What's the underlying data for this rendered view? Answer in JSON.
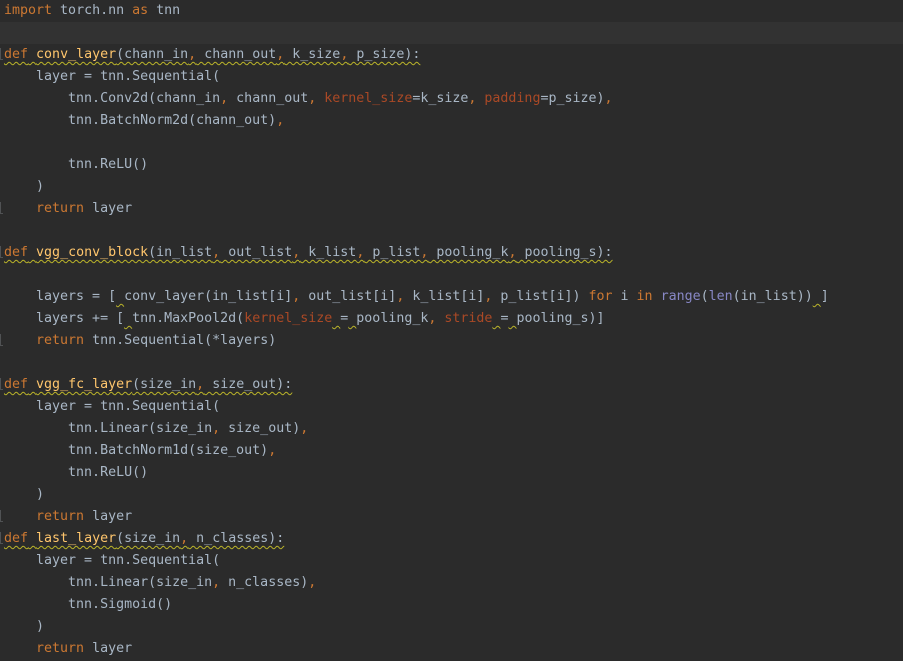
{
  "editor": {
    "lines": [
      [
        {
          "t": "import",
          "c": "kw"
        },
        {
          "t": " torch.nn ",
          "c": "nm"
        },
        {
          "t": "as",
          "c": "kw"
        },
        {
          "t": " tnn",
          "c": "nm"
        }
      ],
      [],
      [
        {
          "t": "def",
          "c": "kw",
          "w": 1
        },
        {
          "t": " ",
          "c": "nm",
          "w": 1
        },
        {
          "t": "conv_layer",
          "c": "fn",
          "w": 1
        },
        {
          "t": "(chann_in",
          "c": "nm",
          "w": 1
        },
        {
          "t": ",",
          "c": "pn",
          "w": 1
        },
        {
          "t": " chann_out",
          "c": "nm",
          "w": 1
        },
        {
          "t": ",",
          "c": "pn",
          "w": 1
        },
        {
          "t": " k_size",
          "c": "nm",
          "w": 1
        },
        {
          "t": ",",
          "c": "pn",
          "w": 1
        },
        {
          "t": " p_size):",
          "c": "nm",
          "w": 1
        }
      ],
      [
        {
          "t": "    layer = tnn.Sequential(",
          "c": "nm"
        }
      ],
      [
        {
          "t": "        tnn.Conv2d(chann_in",
          "c": "nm"
        },
        {
          "t": ",",
          "c": "pn"
        },
        {
          "t": " chann_out",
          "c": "nm"
        },
        {
          "t": ",",
          "c": "pn"
        },
        {
          "t": " ",
          "c": "nm"
        },
        {
          "t": "kernel_size",
          "c": "pr"
        },
        {
          "t": "=k_size",
          "c": "nm"
        },
        {
          "t": ",",
          "c": "pn"
        },
        {
          "t": " ",
          "c": "nm"
        },
        {
          "t": "padding",
          "c": "pr"
        },
        {
          "t": "=p_size)",
          "c": "nm"
        },
        {
          "t": ",",
          "c": "pn"
        }
      ],
      [
        {
          "t": "        tnn.BatchNorm2d(chann_out)",
          "c": "nm"
        },
        {
          "t": ",",
          "c": "pn"
        }
      ],
      [],
      [
        {
          "t": "        tnn.ReLU()",
          "c": "nm"
        }
      ],
      [
        {
          "t": "    )",
          "c": "nm"
        }
      ],
      [
        {
          "t": "    ",
          "c": "nm"
        },
        {
          "t": "return",
          "c": "kw"
        },
        {
          "t": " layer",
          "c": "nm"
        }
      ],
      [],
      [
        {
          "t": "def",
          "c": "kw",
          "w": 1
        },
        {
          "t": " ",
          "c": "nm",
          "w": 1
        },
        {
          "t": "vgg_conv_block",
          "c": "fn",
          "w": 1
        },
        {
          "t": "(in_list",
          "c": "nm",
          "w": 1
        },
        {
          "t": ",",
          "c": "pn",
          "w": 1
        },
        {
          "t": " out_list",
          "c": "nm",
          "w": 1
        },
        {
          "t": ",",
          "c": "pn",
          "w": 1
        },
        {
          "t": " k_list",
          "c": "nm",
          "w": 1
        },
        {
          "t": ",",
          "c": "pn",
          "w": 1
        },
        {
          "t": " p_list",
          "c": "nm",
          "w": 1
        },
        {
          "t": ",",
          "c": "pn",
          "w": 1
        },
        {
          "t": " pooling_k",
          "c": "nm",
          "w": 1
        },
        {
          "t": ",",
          "c": "pn",
          "w": 1
        },
        {
          "t": " pooling_s):",
          "c": "nm",
          "w": 1
        }
      ],
      [],
      [
        {
          "t": "    layers = [",
          "c": "nm"
        },
        {
          "t": " ",
          "c": "nm",
          "w": 1
        },
        {
          "t": "conv_layer(in_list[i]",
          "c": "nm"
        },
        {
          "t": ",",
          "c": "pn"
        },
        {
          "t": " out_list[i]",
          "c": "nm"
        },
        {
          "t": ",",
          "c": "pn"
        },
        {
          "t": " k_list[i]",
          "c": "nm"
        },
        {
          "t": ",",
          "c": "pn"
        },
        {
          "t": " p_list[i]) ",
          "c": "nm"
        },
        {
          "t": "for",
          "c": "kw"
        },
        {
          "t": " i ",
          "c": "nm"
        },
        {
          "t": "in",
          "c": "kw"
        },
        {
          "t": " ",
          "c": "nm"
        },
        {
          "t": "range",
          "c": "bi"
        },
        {
          "t": "(",
          "c": "nm"
        },
        {
          "t": "len",
          "c": "bi"
        },
        {
          "t": "(in_list))",
          "c": "nm"
        },
        {
          "t": " ",
          "c": "nm",
          "w": 1
        },
        {
          "t": "]",
          "c": "nm"
        }
      ],
      [
        {
          "t": "    layers += [",
          "c": "nm"
        },
        {
          "t": " ",
          "c": "nm",
          "w": 1
        },
        {
          "t": "tnn.MaxPool2d(",
          "c": "nm"
        },
        {
          "t": "kernel_size",
          "c": "pr"
        },
        {
          "t": " ",
          "c": "nm",
          "w": 1
        },
        {
          "t": "=",
          "c": "nm"
        },
        {
          "t": " ",
          "c": "nm",
          "w": 1
        },
        {
          "t": "pooling_k",
          "c": "nm"
        },
        {
          "t": ",",
          "c": "pn"
        },
        {
          "t": " ",
          "c": "nm"
        },
        {
          "t": "stride",
          "c": "pr"
        },
        {
          "t": " ",
          "c": "nm",
          "w": 1
        },
        {
          "t": "=",
          "c": "nm"
        },
        {
          "t": " ",
          "c": "nm",
          "w": 1
        },
        {
          "t": "pooling_s)]",
          "c": "nm"
        }
      ],
      [
        {
          "t": "    ",
          "c": "nm"
        },
        {
          "t": "return",
          "c": "kw"
        },
        {
          "t": " tnn.Sequential(*layers)",
          "c": "nm"
        }
      ],
      [],
      [
        {
          "t": "def",
          "c": "kw",
          "w": 1
        },
        {
          "t": " ",
          "c": "nm",
          "w": 1
        },
        {
          "t": "vgg_fc_layer",
          "c": "fn",
          "w": 1
        },
        {
          "t": "(size_in",
          "c": "nm",
          "w": 1
        },
        {
          "t": ",",
          "c": "pn",
          "w": 1
        },
        {
          "t": " size_out):",
          "c": "nm",
          "w": 1
        }
      ],
      [
        {
          "t": "    layer = tnn.Sequential(",
          "c": "nm"
        }
      ],
      [
        {
          "t": "        tnn.Linear(size_in",
          "c": "nm"
        },
        {
          "t": ",",
          "c": "pn"
        },
        {
          "t": " size_out)",
          "c": "nm"
        },
        {
          "t": ",",
          "c": "pn"
        }
      ],
      [
        {
          "t": "        tnn.BatchNorm1d(size_out)",
          "c": "nm"
        },
        {
          "t": ",",
          "c": "pn"
        }
      ],
      [
        {
          "t": "        tnn.ReLU()",
          "c": "nm"
        }
      ],
      [
        {
          "t": "    )",
          "c": "nm"
        }
      ],
      [
        {
          "t": "    ",
          "c": "nm"
        },
        {
          "t": "return",
          "c": "kw"
        },
        {
          "t": " layer",
          "c": "nm"
        }
      ],
      [
        {
          "t": "def",
          "c": "kw",
          "w": 1
        },
        {
          "t": " ",
          "c": "nm",
          "w": 1
        },
        {
          "t": "last_layer",
          "c": "fn",
          "w": 1
        },
        {
          "t": "(size_in",
          "c": "nm",
          "w": 1
        },
        {
          "t": ",",
          "c": "pn",
          "w": 1
        },
        {
          "t": " n_classes):",
          "c": "nm",
          "w": 1
        }
      ],
      [
        {
          "t": "    layer = tnn.Sequential(",
          "c": "nm"
        }
      ],
      [
        {
          "t": "        tnn.Linear(size_in",
          "c": "nm"
        },
        {
          "t": ",",
          "c": "pn"
        },
        {
          "t": " n_classes)",
          "c": "nm"
        },
        {
          "t": ",",
          "c": "pn"
        }
      ],
      [
        {
          "t": "        tnn.Sigmoid()",
          "c": "nm"
        }
      ],
      [
        {
          "t": "    )",
          "c": "nm"
        }
      ],
      [
        {
          "t": "    ",
          "c": "nm"
        },
        {
          "t": "return",
          "c": "kw"
        },
        {
          "t": " layer",
          "c": "nm"
        }
      ]
    ],
    "current_line": 1,
    "gutter_marks": [
      2,
      9,
      11,
      15,
      17,
      23,
      24
    ]
  },
  "theme": {
    "background": "#2b2b2b",
    "current_line": "#323232",
    "keyword": "#cc7832",
    "function": "#ffc66d",
    "identifier": "#a9b7c6",
    "param": "#aa4926",
    "builtin": "#8888c6",
    "warning_underline": "#bbb529"
  }
}
